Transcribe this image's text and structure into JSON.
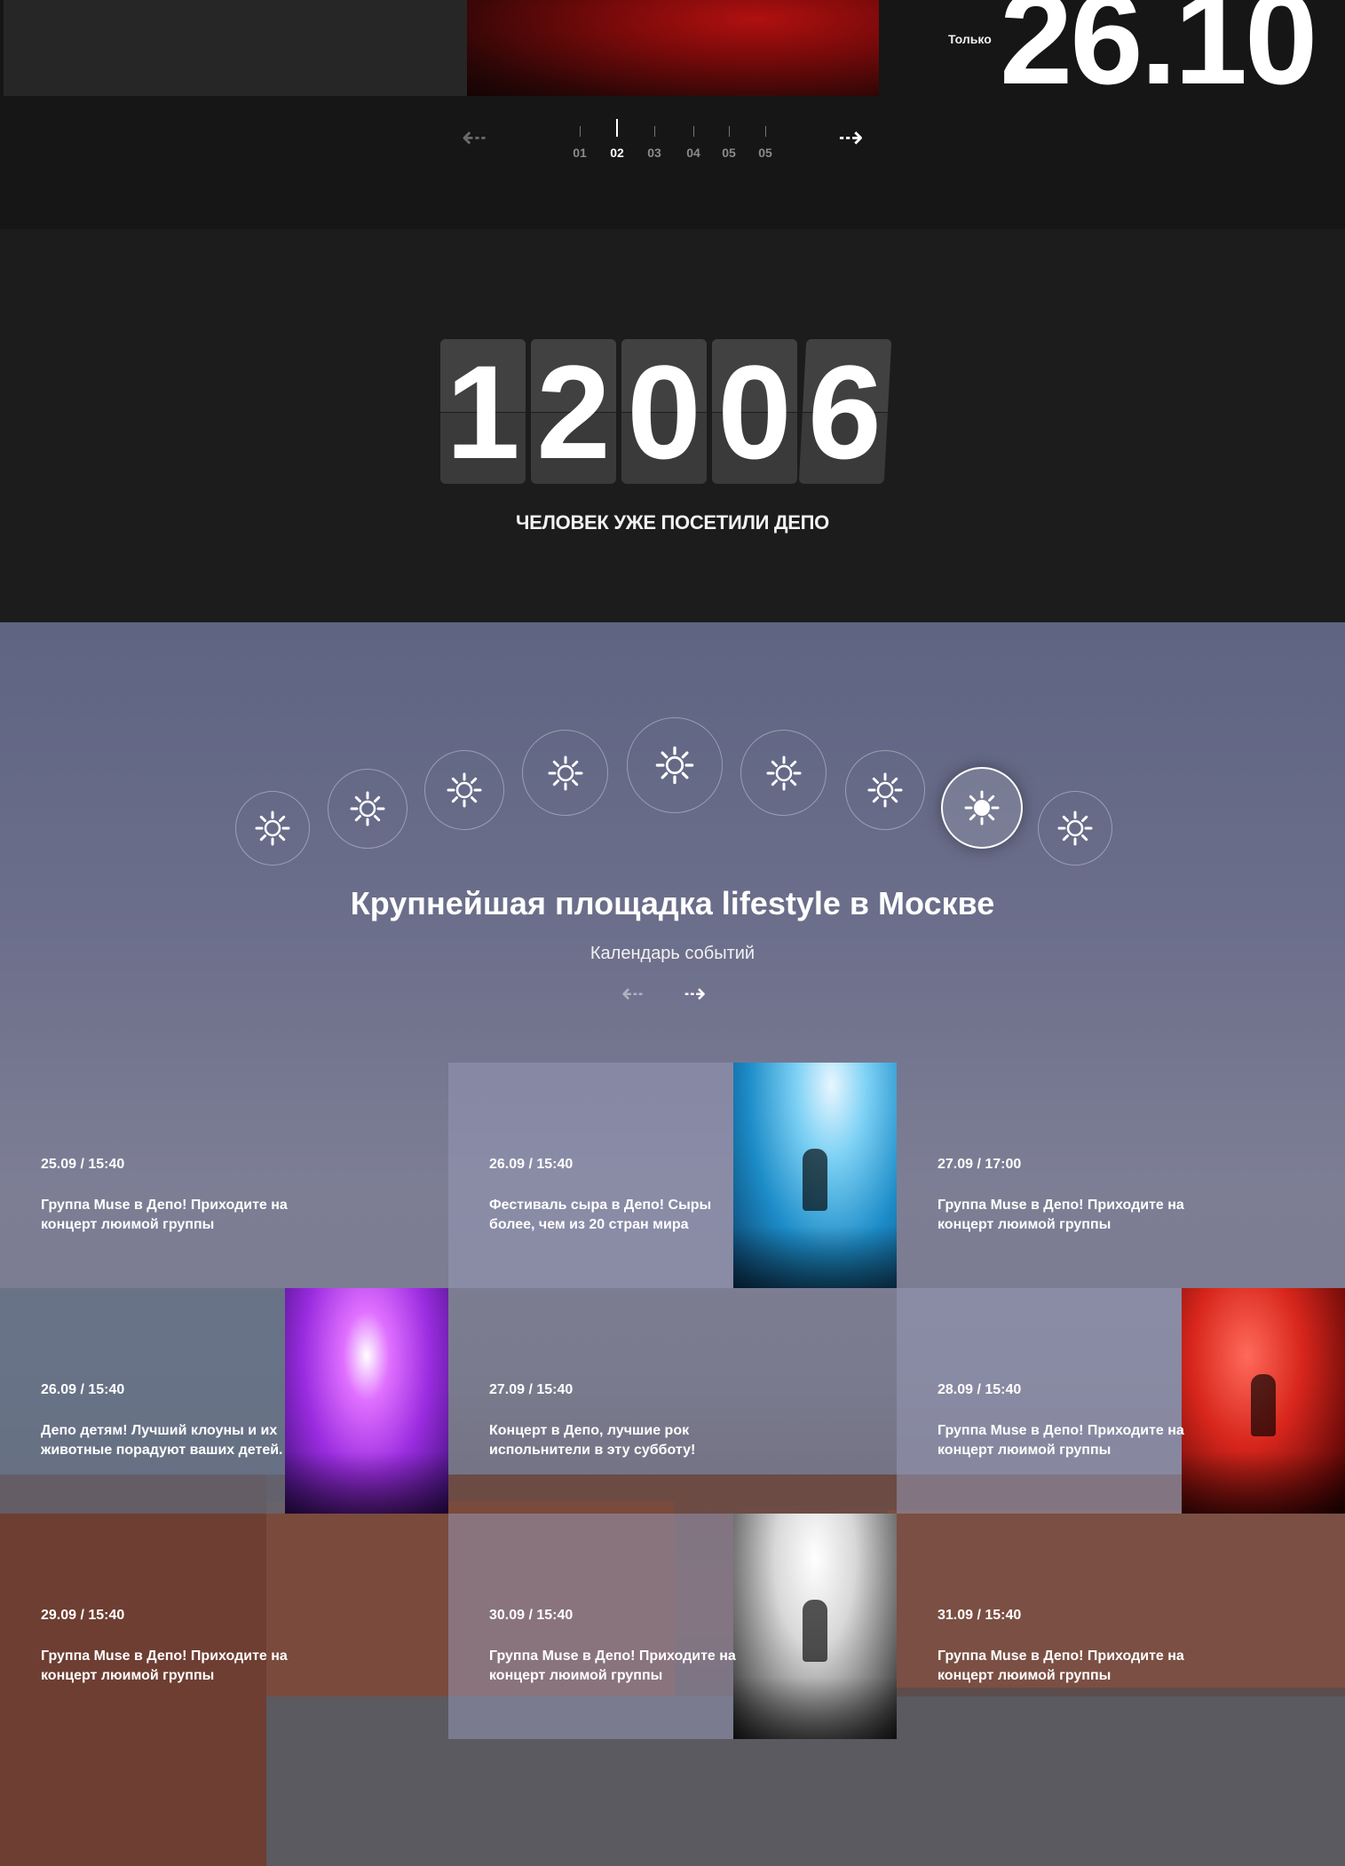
{
  "slider": {
    "only_label": "Только",
    "date": "26.10",
    "prev_arrow": "⇠",
    "next_arrow": "⇢",
    "pages": [
      "01",
      "02",
      "03",
      "04",
      "05",
      "05"
    ],
    "active_page": 1
  },
  "counter": {
    "digits": [
      "1",
      "2",
      "0",
      "0",
      "6"
    ],
    "caption": "ЧЕЛОВЕК УЖЕ ПОСЕТИЛИ ДЕПО"
  },
  "events": {
    "title": "Крупнейшая площадка lifestyle в Москве",
    "subtitle": "Календарь событий",
    "prev_arrow": "⇠",
    "next_arrow": "⇢",
    "weather_icons": [
      "sun-icon",
      "sun-icon",
      "sun-icon",
      "sun-icon",
      "sun-icon",
      "sun-icon",
      "sun-icon",
      "sun-icon",
      "sun-icon"
    ],
    "active_weather_icon": 7,
    "tiles": [
      {
        "date": "25.09 / 15:40",
        "text": "Группа Muse в Депо! Приходите на концерт люимой группы"
      },
      {
        "date": "26.09 / 15:40",
        "text": "Фестиваль сыра в Депо! Сыры более, чем из 20 стран мира"
      },
      {
        "date": "27.09  / 17:00",
        "text": "Группа Muse в Депо! Приходите на концерт люимой группы"
      },
      {
        "date": "26.09 / 15:40",
        "text": "Депо детям! Лучший клоуны и их животные порадуют ваших детей."
      },
      {
        "date": "27.09 / 15:40",
        "text": "Концерт в Депо, лучшие рок испольнители в эту субботу!"
      },
      {
        "date": "28.09  / 15:40",
        "text": "Группа Muse в Депо! Приходите на концерт люимой группы"
      },
      {
        "date": "29.09  / 15:40",
        "text": "Группа Muse в Депо! Приходите на концерт люимой группы"
      },
      {
        "date": "30.09  / 15:40",
        "text": "Группа Muse в Депо! Приходите на концерт люимой группы"
      },
      {
        "date": "31.09 / 15:40",
        "text": "Группа Muse в Депо! Приходите на концерт люимой группы"
      }
    ]
  }
}
